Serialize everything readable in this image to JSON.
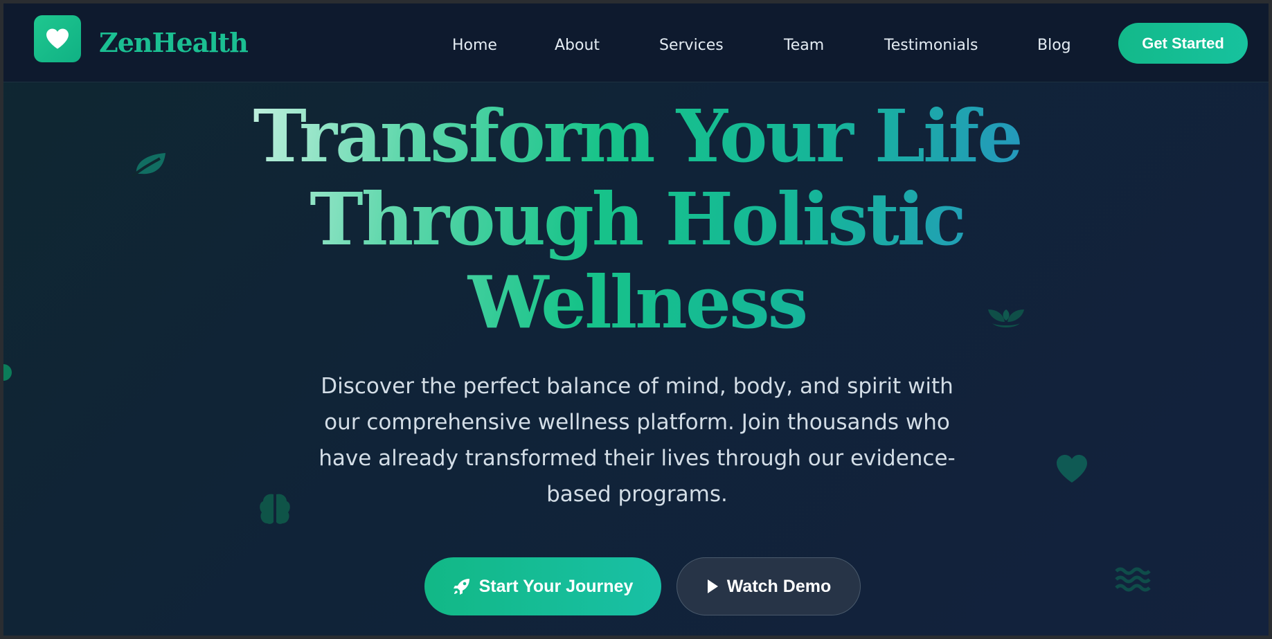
{
  "brand": {
    "name": "ZenHealth",
    "logo_icon": "heart-icon",
    "accent_color": "#10b981"
  },
  "nav": {
    "links": [
      {
        "label": "Home"
      },
      {
        "label": "About"
      },
      {
        "label": "Services"
      },
      {
        "label": "Team"
      },
      {
        "label": "Testimonials"
      },
      {
        "label": "Blog"
      }
    ],
    "cta_label": "Get Started"
  },
  "hero": {
    "headline_lines": [
      "Transform Your Life",
      "Through Holistic",
      "Wellness"
    ],
    "subtext": "Discover the perfect balance of mind, body, and spirit with our comprehensive wellness platform. Join thousands who have already transformed their lives through our evidence-based programs.",
    "primary_button": {
      "label": "Start Your Journey",
      "icon": "rocket-icon"
    },
    "secondary_button": {
      "label": "Watch Demo",
      "icon": "play-icon"
    }
  },
  "decorations": [
    "leaf-icon",
    "seedling-icon",
    "brain-icon",
    "heart-icon",
    "waves-icon",
    "circle-icon"
  ]
}
